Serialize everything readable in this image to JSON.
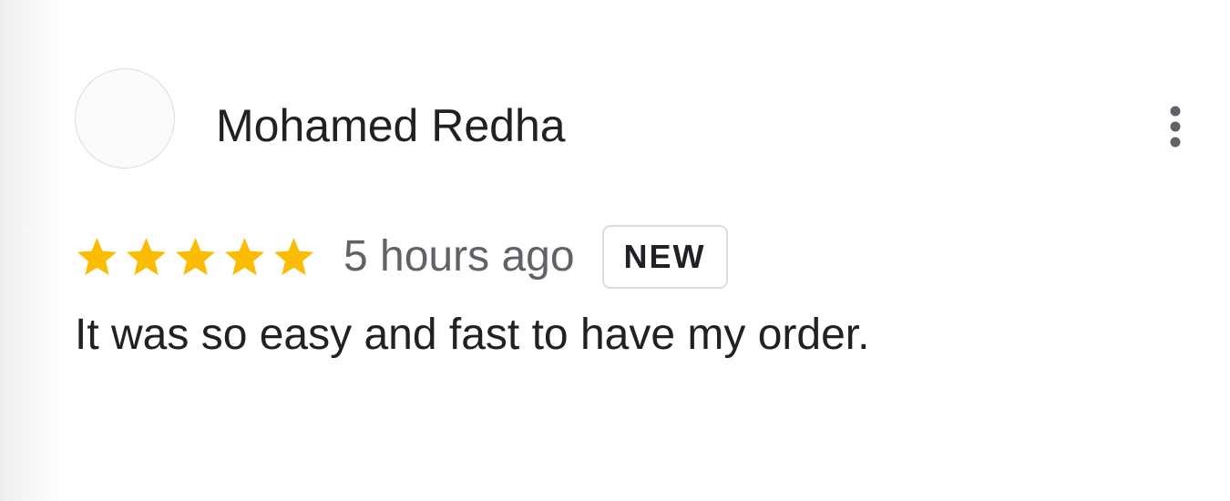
{
  "review": {
    "reviewer_name": "Mohamed Redha",
    "rating": 5,
    "rating_max": 5,
    "time_ago": "5 hours ago",
    "badge": "NEW",
    "text": "It was so easy and fast to have my order."
  },
  "icons": {
    "avatar": "avatar-placeholder",
    "star": "star-icon",
    "more": "more-vert-icon"
  },
  "colors": {
    "star": "#FBBC04",
    "name_text": "#202124",
    "secondary_text": "#5F6368",
    "badge_border": "#DADCE0"
  }
}
